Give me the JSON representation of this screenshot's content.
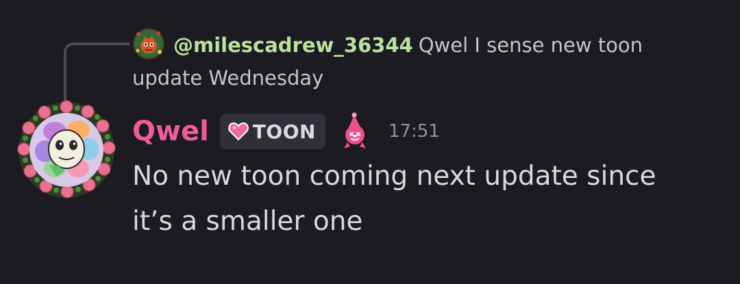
{
  "reply": {
    "author": "@milescadrew_36344",
    "text_line1": "Qwel I sense new toon",
    "text_line2": "update Wednesday",
    "avatar_icon": "red-creature-avatar"
  },
  "message": {
    "author": "Qwel",
    "tag": {
      "icon": "pink-heart-icon",
      "label": "TOON"
    },
    "role_icon": "pink-clown-icon",
    "timestamp": "17:51",
    "lines": [
      "No new toon coming next update since",
      "it’s a smaller one"
    ],
    "avatar_icon": "flower-character-avatar"
  },
  "colors": {
    "background": "#1c1b21",
    "author_name": "#f15b9a",
    "reply_author": "#b7e39c",
    "text": "#d8d9de",
    "muted": "#91929b"
  }
}
